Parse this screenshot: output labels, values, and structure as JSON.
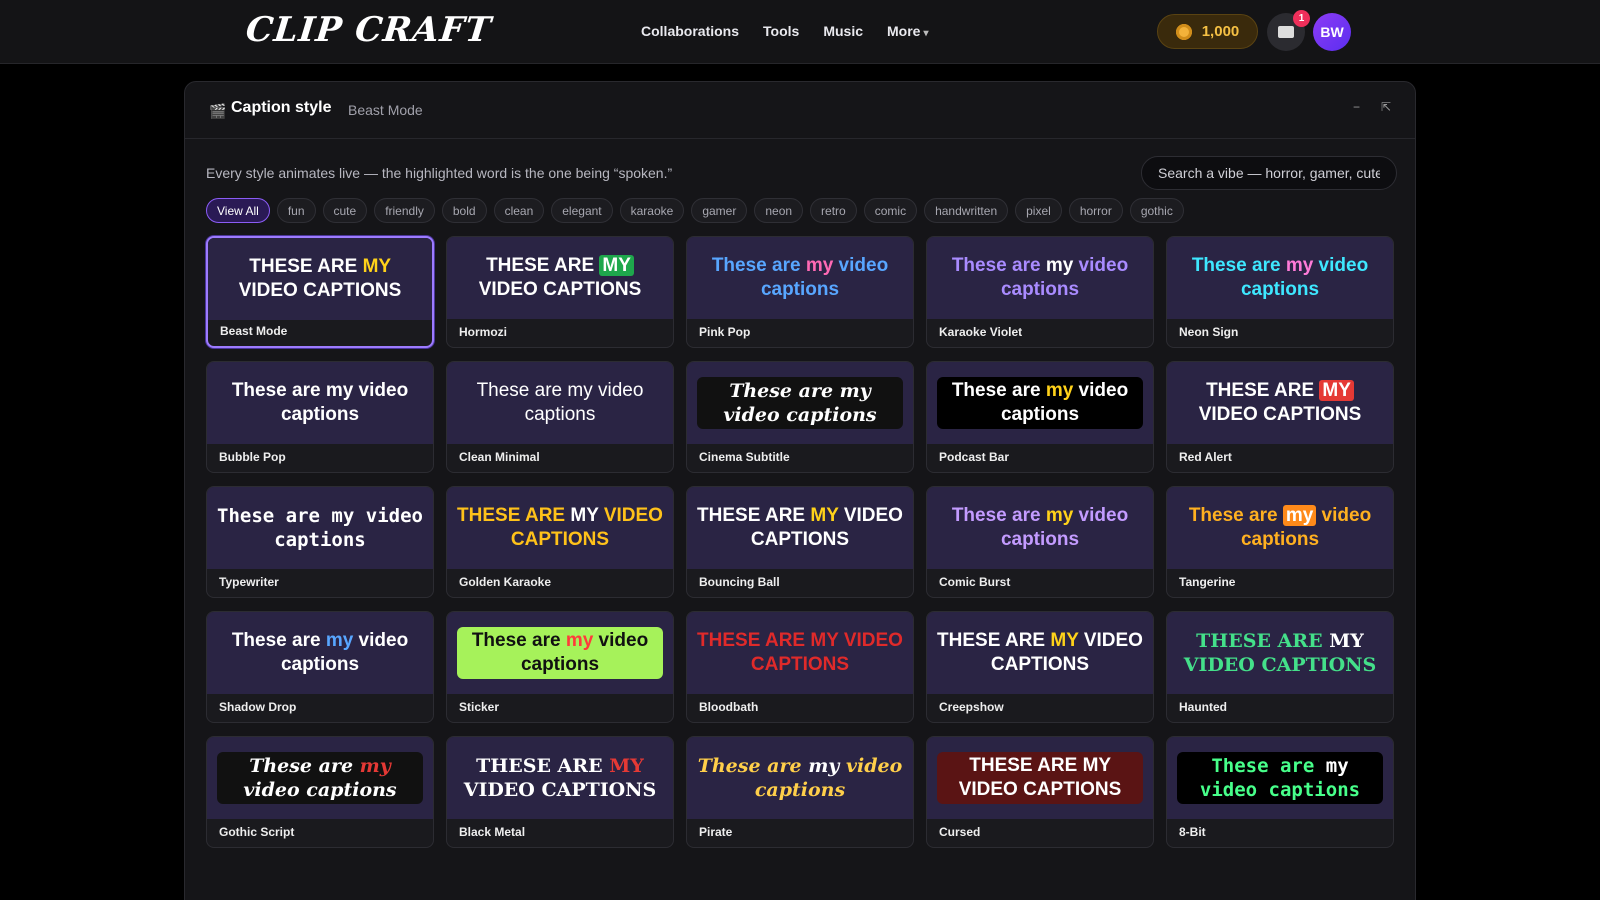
{
  "app": {
    "logo": "CLIP CRAFT"
  },
  "nav": {
    "items": [
      "Collaborations",
      "Tools",
      "Music"
    ],
    "more": "More"
  },
  "account": {
    "coins": "1,000",
    "notifications": "1",
    "avatar": "BW"
  },
  "panel": {
    "title": "Caption style",
    "current": "Beast Mode",
    "description": "Every style animates live — the highlighted word is the one being “spoken.”",
    "search_placeholder": "Search a vibe — horror, gamer, cute…"
  },
  "tags": [
    "View All",
    "fun",
    "cute",
    "friendly",
    "bold",
    "clean",
    "elegant",
    "karaoke",
    "gamer",
    "neon",
    "retro",
    "comic",
    "handwritten",
    "pixel",
    "horror",
    "gothic"
  ],
  "active_tag": "View All",
  "preview": {
    "a": "These are",
    "hi": "my",
    "b": "video captions"
  },
  "styles": [
    {
      "name": "Beast Mode",
      "caps": true,
      "font": "bold",
      "color": "#ffffff",
      "hi": "#ffd21a",
      "hibg": "",
      "bg": "",
      "selected": true
    },
    {
      "name": "Hormozi",
      "caps": true,
      "font": "bold",
      "color": "#ffffff",
      "hi": "#ffffff",
      "hibg": "#1ea74c",
      "bg": ""
    },
    {
      "name": "Pink Pop",
      "caps": false,
      "font": "bold",
      "color": "#58a6ff",
      "hi": "#ff69b4",
      "hibg": "",
      "bg": ""
    },
    {
      "name": "Karaoke Violet",
      "caps": false,
      "font": "bold",
      "color": "#a98bff",
      "hi": "#ffffff",
      "hibg": "",
      "bg": ""
    },
    {
      "name": "Neon Sign",
      "caps": false,
      "font": "bold",
      "color": "#3ee7ff",
      "hi": "#ff7bd8",
      "hibg": "",
      "bg": ""
    },
    {
      "name": "Bubble Pop",
      "caps": false,
      "font": "bold",
      "color": "#ffffff",
      "hi": "#ffffff",
      "hibg": "",
      "bg": ""
    },
    {
      "name": "Clean Minimal",
      "caps": false,
      "font": "regular",
      "color": "#ffffff",
      "hi": "#ffffff",
      "hibg": "",
      "bg": ""
    },
    {
      "name": "Cinema Subtitle",
      "caps": false,
      "font": "serif",
      "color": "#ffffff",
      "hi": "#ffffff",
      "hibg": "",
      "bg": "#111111"
    },
    {
      "name": "Podcast Bar",
      "caps": false,
      "font": "bold",
      "color": "#ffffff",
      "hi": "#ffd21a",
      "hibg": "",
      "bg": "#000000"
    },
    {
      "name": "Red Alert",
      "caps": true,
      "font": "bold",
      "color": "#ffffff",
      "hi": "#ffffff",
      "hibg": "#e53935",
      "bg": ""
    },
    {
      "name": "Typewriter",
      "caps": false,
      "font": "mono",
      "color": "#ffffff",
      "hi": "#ffffff",
      "hibg": "",
      "bg": ""
    },
    {
      "name": "Golden Karaoke",
      "caps": true,
      "font": "bold",
      "color": "#ffc21a",
      "hi": "#ffffff",
      "hibg": "",
      "bg": ""
    },
    {
      "name": "Bouncing Ball",
      "caps": true,
      "font": "bold",
      "color": "#ffffff",
      "hi": "#ffd21a",
      "hibg": "",
      "bg": ""
    },
    {
      "name": "Comic Burst",
      "caps": false,
      "font": "bold",
      "color": "#c39bff",
      "hi": "#ffd21a",
      "hibg": "",
      "bg": ""
    },
    {
      "name": "Tangerine",
      "caps": false,
      "font": "bold",
      "color": "#ffb020",
      "hi": "#ffffff",
      "hibg": "#ff8a1a",
      "bg": ""
    },
    {
      "name": "Shadow Drop",
      "caps": false,
      "font": "bold",
      "color": "#ffffff",
      "hi": "#58a6ff",
      "hibg": "",
      "bg": ""
    },
    {
      "name": "Sticker",
      "caps": false,
      "font": "bold",
      "color": "#111111",
      "hi": "#ff3a3a",
      "hibg": "",
      "bg": "#a6f25a"
    },
    {
      "name": "Bloodbath",
      "caps": true,
      "font": "bold",
      "color": "#e02a2a",
      "hi": "#e02a2a",
      "hibg": "",
      "bg": ""
    },
    {
      "name": "Creepshow",
      "caps": true,
      "font": "bold",
      "color": "#ffffff",
      "hi": "#ffd21a",
      "hibg": "",
      "bg": ""
    },
    {
      "name": "Haunted",
      "caps": true,
      "font": "serif",
      "color": "#44e08a",
      "hi": "#ffffff",
      "hibg": "",
      "bg": ""
    },
    {
      "name": "Gothic Script",
      "caps": false,
      "font": "serif",
      "color": "#ffffff",
      "hi": "#e53935",
      "hibg": "",
      "bg": "#111111"
    },
    {
      "name": "Black Metal",
      "caps": true,
      "font": "serif",
      "color": "#ffffff",
      "hi": "#e53935",
      "hibg": "",
      "bg": ""
    },
    {
      "name": "Pirate",
      "caps": false,
      "font": "serif",
      "color": "#ffcf4a",
      "hi": "#ffffff",
      "hibg": "",
      "bg": ""
    },
    {
      "name": "Cursed",
      "caps": true,
      "font": "bold",
      "color": "#ffffff",
      "hi": "#ffffff",
      "hibg": "",
      "bg": "#5a1414"
    },
    {
      "name": "8-Bit",
      "caps": false,
      "font": "mono",
      "color": "#47ff8a",
      "hi": "#ffffff",
      "hibg": "",
      "bg": "#000000"
    }
  ]
}
